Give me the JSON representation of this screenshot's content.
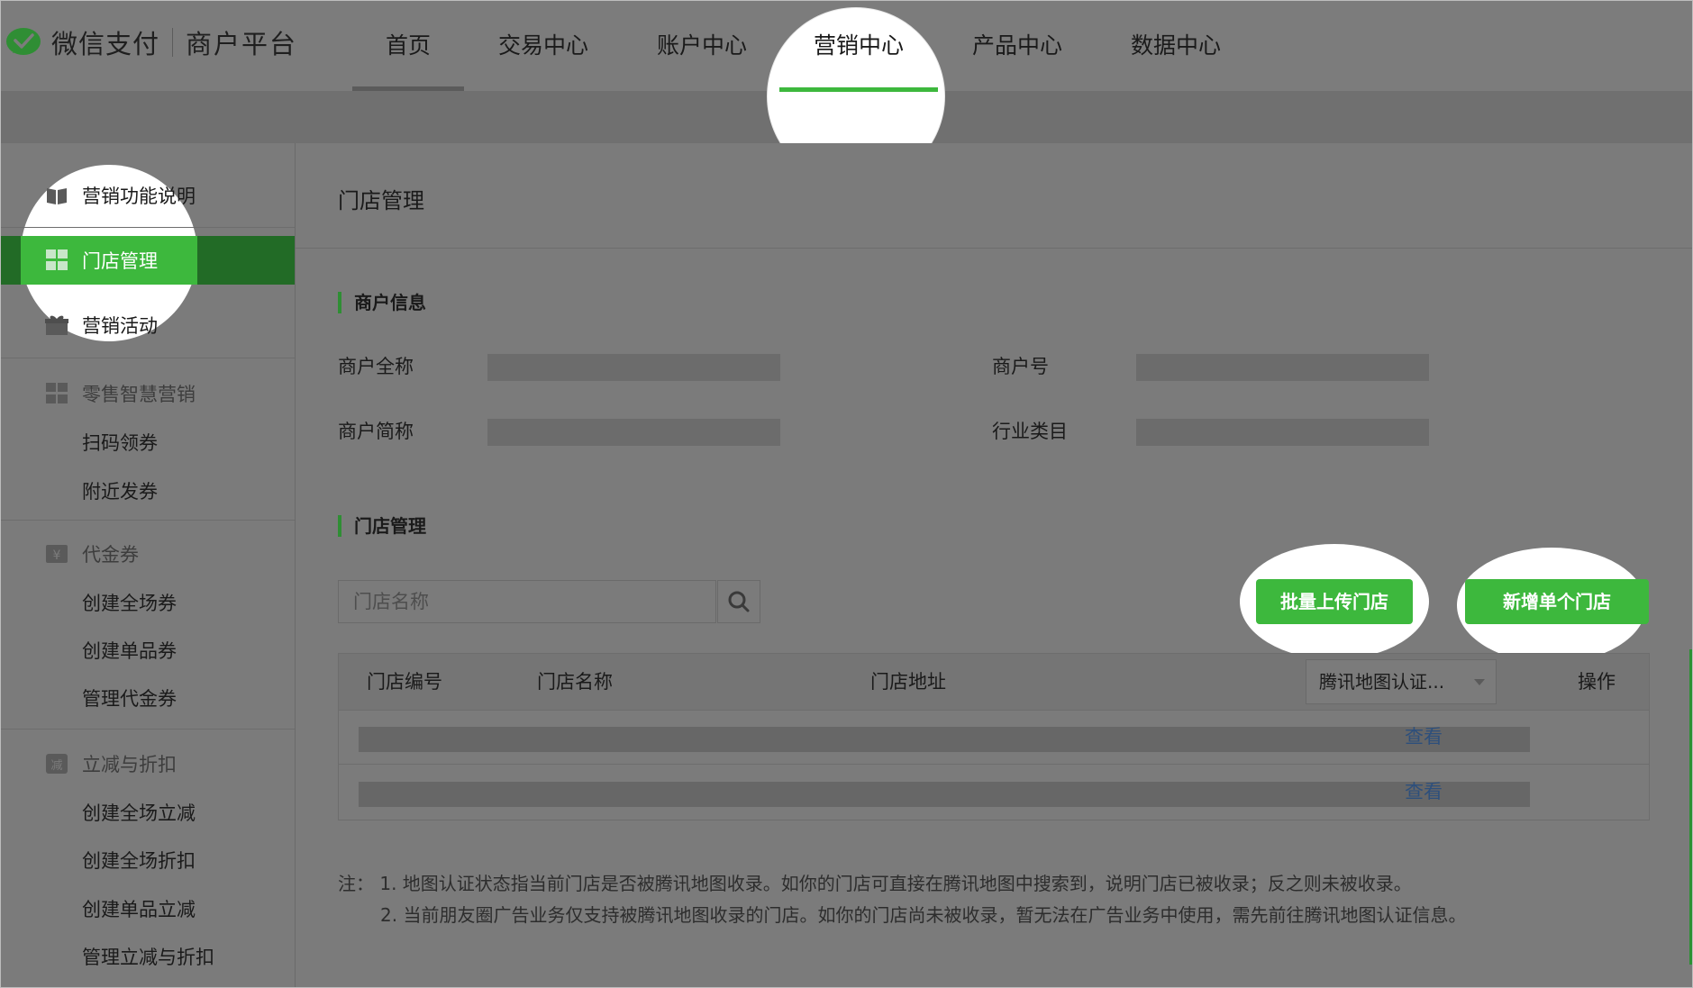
{
  "brand": {
    "name": "微信支付",
    "sub": "商户平台"
  },
  "nav": {
    "items": [
      {
        "label": "首页"
      },
      {
        "label": "交易中心"
      },
      {
        "label": "账户中心"
      },
      {
        "label": "营销中心"
      },
      {
        "label": "产品中心"
      },
      {
        "label": "数据中心"
      }
    ]
  },
  "sidebar": {
    "intro": "营销功能说明",
    "store_mgmt": "门店管理",
    "activity": "营销活动",
    "retail": {
      "label": "零售智慧营销",
      "items": [
        "扫码领券",
        "附近发券"
      ]
    },
    "voucher": {
      "label": "代金券",
      "items": [
        "创建全场券",
        "创建单品券",
        "管理代金券"
      ]
    },
    "discount": {
      "label": "立减与折扣",
      "items": [
        "创建全场立减",
        "创建全场折扣",
        "创建单品立减",
        "管理立减与折扣"
      ]
    }
  },
  "main": {
    "title": "门店管理",
    "merchant_section": "商户信息",
    "fields": {
      "full_name": "商户全称",
      "merchant_no": "商户号",
      "short_name": "商户简称",
      "industry": "行业类目"
    },
    "store_section": "门店管理",
    "search_placeholder": "门店名称",
    "batch_upload": "批量上传门店",
    "add_single": "新增单个门店",
    "table": {
      "col_id": "门店编号",
      "col_name": "门店名称",
      "col_addr": "门店地址",
      "col_map": "腾讯地图认证...",
      "col_action": "操作",
      "rows": [
        {
          "action": "查看"
        },
        {
          "action": "查看"
        }
      ]
    },
    "notes": {
      "line1": "注：  1. 地图认证状态指当前门店是否被腾讯地图收录。如你的门店可直接在腾讯地图中搜索到，说明门店已被收录；反之则未被收录。",
      "line2": "2. 当前朋友圈广告业务仅支持被腾讯地图收录的门店。如你的门店尚未被收录，暂无法在广告业务中使用，需先前往腾讯地图认证信息。"
    }
  },
  "colors": {
    "accent_green": "#3db83d",
    "active_dark_green": "#226b26",
    "link_blue": "#2d4f7c",
    "overlay_gray": "#7b7b7b"
  }
}
